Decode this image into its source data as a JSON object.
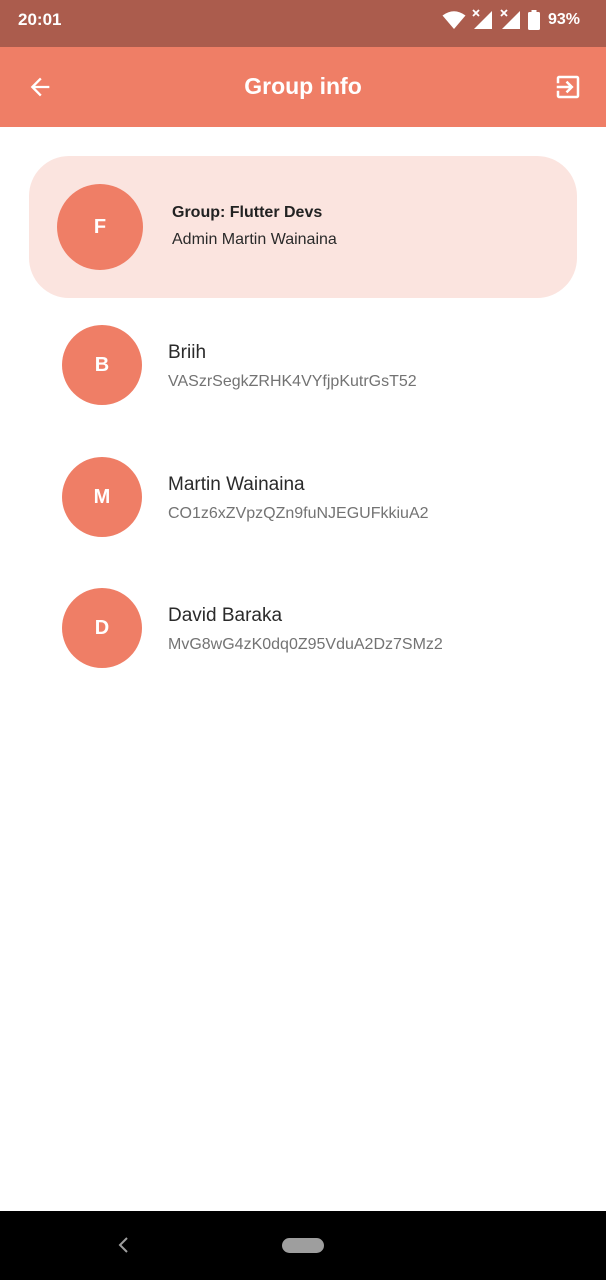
{
  "status_bar": {
    "time": "20:01",
    "battery": "93%",
    "icons": [
      "wifi-icon",
      "signal-icon",
      "signal-icon",
      "battery-icon"
    ]
  },
  "app_bar": {
    "title": "Group info",
    "back_icon": "arrow-left-icon",
    "action_icon": "exit-icon"
  },
  "group": {
    "initial": "F",
    "name": "Group: Flutter Devs",
    "admin": "Admin Martin Wainaina"
  },
  "members": [
    {
      "initial": "B",
      "name": "Briih",
      "id": "VASzrSegkZRHK4VYfjpKutrGsT52"
    },
    {
      "initial": "M",
      "name": "Martin Wainaina",
      "id": "CO1z6xZVpzQZn9fuNJEGUFkkiuA2"
    },
    {
      "initial": "D",
      "name": "David Baraka",
      "id": "MvG8wG4zK0dq0Z95VduA2Dz7SMz2"
    }
  ],
  "colors": {
    "status_bar": "#ab5c4d",
    "accent": "#ef7e66",
    "card_background": "#fbe4df"
  }
}
